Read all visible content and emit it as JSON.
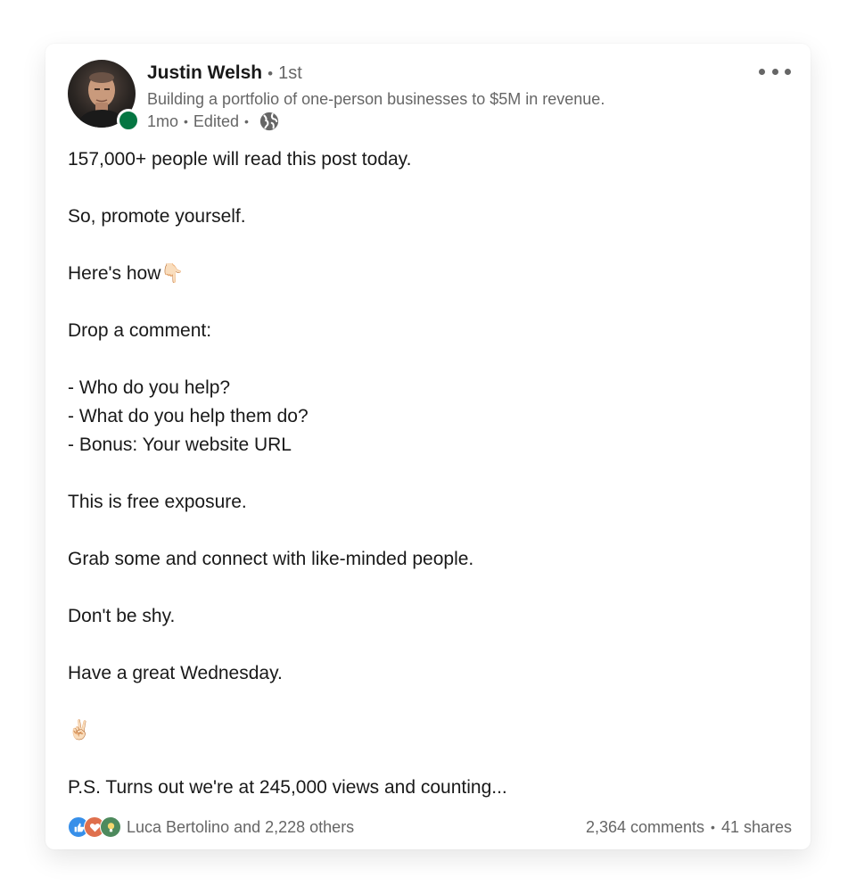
{
  "author": {
    "name": "Justin Welsh",
    "degree": "1st",
    "headline": "Building a portfolio of one-person businesses to $5M in revenue.",
    "time": "1mo",
    "edited": "Edited",
    "visibility_icon": "globe-icon",
    "status": "online"
  },
  "post": {
    "lines": [
      "157,000+ people will read this post today.",
      "",
      "So, promote yourself.",
      "",
      "Here's how",
      "",
      "Drop a comment:",
      "",
      "- Who do you help?",
      "- What do you help them do?",
      "- Bonus: Your website URL",
      "",
      "This is free exposure.",
      "",
      "Grab some and connect with like-minded people.",
      "",
      "Don't be shy.",
      "",
      "Have a great Wednesday.",
      "",
      "",
      "",
      "P.S. Turns out we're at 245,000 views and counting..."
    ],
    "emoji_pointing_down": "👇🏻",
    "emoji_victory": "✌🏻"
  },
  "footer": {
    "reactions_text": "Luca Bertolino and 2,228 others",
    "reaction_icons": [
      "like-icon",
      "love-icon",
      "insightful-icon"
    ],
    "comments": "2,364 comments",
    "shares": "41 shares"
  },
  "colors": {
    "online": "#057642",
    "like": "#378fe9",
    "love": "#df704d",
    "insightful": "#4d8a5d",
    "secondary_text": "#666666"
  }
}
